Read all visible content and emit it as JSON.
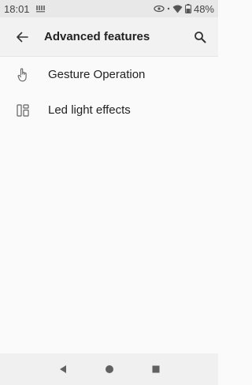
{
  "status_bar": {
    "time": "18:01",
    "battery": "48%",
    "icons": [
      "notification-icon",
      "eye-icon",
      "wifi-icon",
      "battery-icon"
    ]
  },
  "app_bar": {
    "title": "Advanced features",
    "back_icon": "arrow-back-icon",
    "search_icon": "search-icon"
  },
  "items": [
    {
      "label": "Gesture Operation",
      "icon": "hand-gesture-icon"
    },
    {
      "label": "Led light effects",
      "icon": "led-layout-icon"
    }
  ],
  "nav_bar": {
    "buttons": [
      "back-triangle-icon",
      "home-circle-icon",
      "recents-square-icon"
    ]
  },
  "colors": {
    "status_bg": "#e8e8e8",
    "app_bar_bg": "#f2f2f2",
    "page_bg": "#fafafa",
    "text": "#222222",
    "icon": "#616161"
  }
}
